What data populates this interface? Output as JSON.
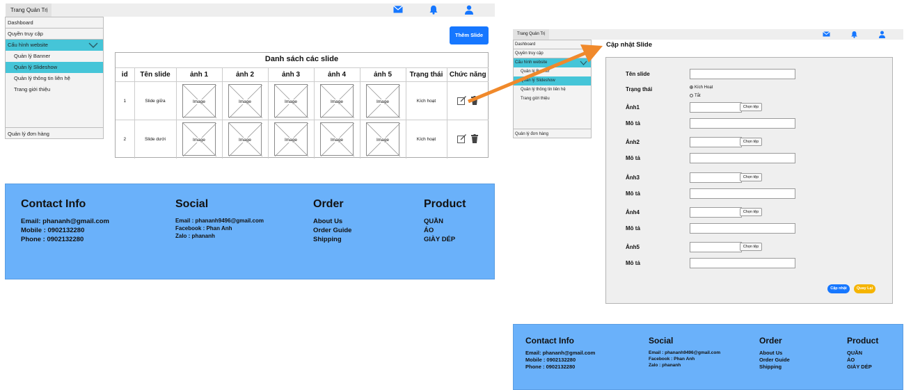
{
  "left": {
    "topbar": {
      "title": "Trang Quản Trị"
    },
    "sidebar": {
      "items": [
        "Dashboard",
        "Quyền truy cập",
        "Cấu hình website"
      ],
      "subitems": [
        "Quản lý Banner",
        "Quản lý Slideshow",
        "Quản lý thông tin liên hệ",
        "Trang giới thiệu"
      ],
      "bottom": "Quản lý đơn hàng"
    },
    "add_button": "Thêm Slide",
    "table": {
      "title": "Danh sách các slide",
      "headers": [
        "id",
        "Tên slide",
        "ảnh 1",
        "ảnh 2",
        "ảnh 3",
        "ảnh 4",
        "ảnh 5",
        "Trạng thái",
        "Chức năng"
      ],
      "image_label": "Image",
      "rows": [
        {
          "id": "1",
          "name": "Slide giữa",
          "status": "Kích hoạt"
        },
        {
          "id": "2",
          "name": "Slide dưới",
          "status": "Kích hoạt"
        }
      ]
    }
  },
  "footer": {
    "contact": {
      "title": "Contact Info",
      "lines": [
        "Email: phananh@gmail.com",
        "Mobile : 0902132280",
        "Phone : 0902132280"
      ]
    },
    "social": {
      "title": "Social",
      "lines": [
        "Email : phananh9496@gmail.com",
        "Facebook : Phan Anh",
        "Zalo : phananh"
      ]
    },
    "order": {
      "title": "Order",
      "lines": [
        "About Us",
        "Order Guide",
        "Shipping"
      ]
    },
    "product": {
      "title": "Product",
      "lines": [
        "QUẦN",
        "ÁO",
        "GIÀY DÉP"
      ]
    }
  },
  "right": {
    "topbar": {
      "title": "Trang Quản Trị"
    },
    "sidebar": {
      "items": [
        "Dashboard",
        "Quyền truy cập",
        "Cấu hình website"
      ],
      "subitems": [
        "Quản lý Banner",
        "Quản lý Slideshow",
        "Quản lý thông tin liên hệ",
        "Trang giới thiệu"
      ],
      "bottom": "Quản lý đơn hàng"
    },
    "form": {
      "title": "Cập nhật Slide",
      "name_label": "Tên slide",
      "status_label": "Trạng thái",
      "status_options": [
        "Kích Hoạt",
        "Tắt"
      ],
      "image_labels": [
        "Ảnh1",
        "Ảnh2",
        "Ảnh3",
        "Ảnh4",
        "Ảnh5"
      ],
      "desc_label": "Mô tả",
      "choose_file": "Chọn tệp",
      "update_button": "Cập nhật",
      "back_button": "Quay Lại"
    }
  },
  "colors": {
    "accent": "#45c5d8",
    "primary": "#1677ff",
    "footer": "#6ab1fa",
    "back": "#f5b400",
    "arrow": "#f0892b",
    "icon": "#1677ff"
  }
}
